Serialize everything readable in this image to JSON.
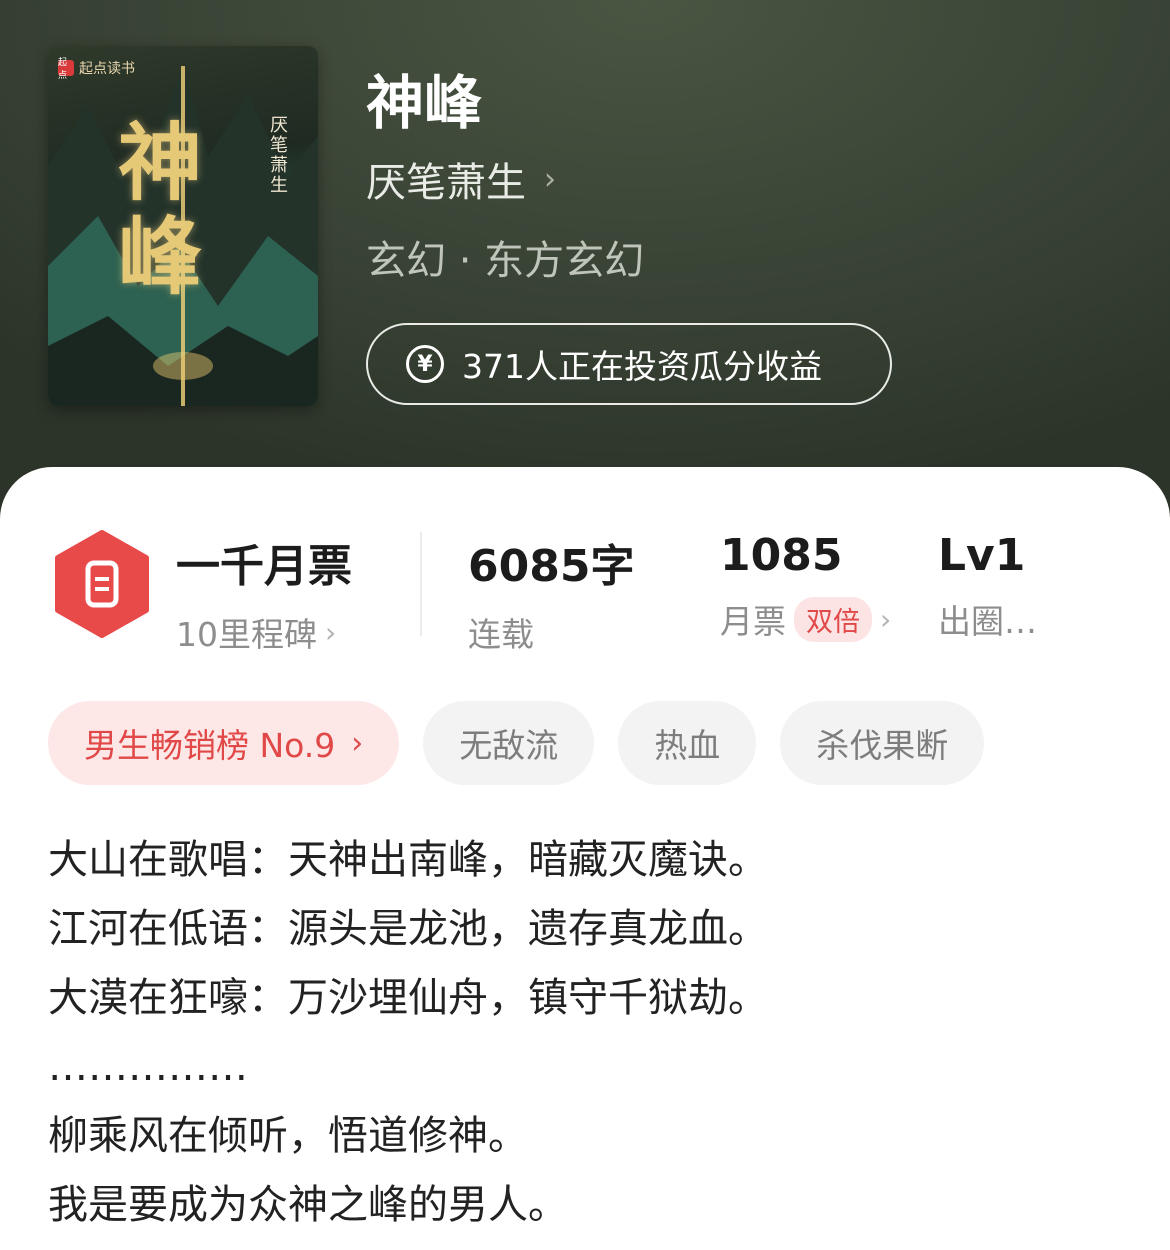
{
  "book": {
    "title": "神峰",
    "author": "厌笔萧生",
    "author_chevron": "›",
    "genre": "玄幻 · 东方玄幻",
    "invest_text": "371人正在投资瓜分收益",
    "invest_icon": "yen-coin-icon",
    "cover": {
      "publisher": "起点读书",
      "publisher_logo": "起点",
      "title": "神峰",
      "author_vertical": "厌笔萧生"
    }
  },
  "stats": {
    "milestone": {
      "value": "一千月票",
      "label": "10里程碑",
      "chevron": "›",
      "icon": "ticket-badge-icon"
    },
    "words": {
      "value": "6085字",
      "label": "连载"
    },
    "monthly_votes": {
      "value": "1085",
      "label": "月票",
      "tag": "双倍",
      "chevron": "›"
    },
    "level": {
      "value": "Lv1",
      "label": "出圈…"
    }
  },
  "tags": [
    {
      "label": "男生畅销榜 No.9",
      "chevron": "›"
    },
    {
      "label": "无敌流"
    },
    {
      "label": "热血"
    },
    {
      "label": "杀伐果断"
    }
  ],
  "synopsis": [
    "大山在歌唱：天神出南峰，暗藏灭魔诀。",
    "江河在低语：源头是龙池，遗存真龙血。",
    "大漠在狂嚎：万沙埋仙舟，镇守千狱劫。",
    "……………",
    "柳乘风在倾听，悟道修神。",
    "我是要成为众神之峰的男人。"
  ],
  "colors": {
    "accent_red": "#e14848",
    "header_bg": "#3b4437"
  }
}
